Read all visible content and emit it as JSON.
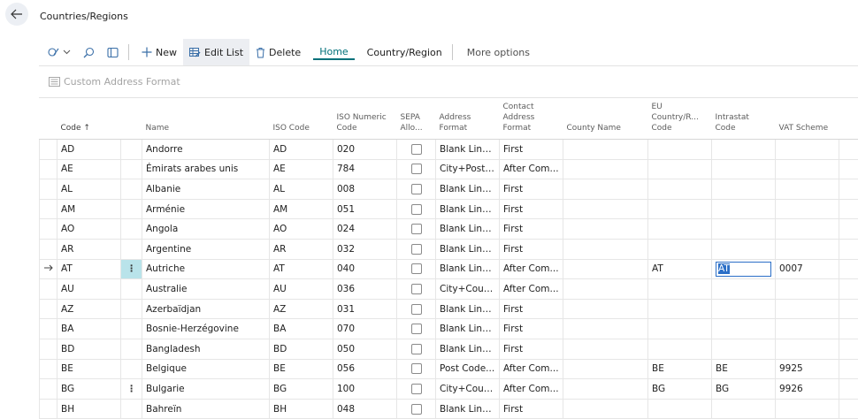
{
  "page": {
    "title": "Countries/Regions"
  },
  "toolbar": {
    "new_label": "New",
    "edit_list_label": "Edit List",
    "delete_label": "Delete",
    "home_label": "Home",
    "country_region_label": "Country/Region",
    "more_options_label": "More options"
  },
  "sub_actions": {
    "custom_address_format_label": "Custom Address Format"
  },
  "table": {
    "headers": {
      "code": "Code ↑",
      "name": "Name",
      "iso_code": "ISO Code",
      "iso_numeric_1": "ISO Numeric",
      "iso_numeric_2": "Code",
      "sepa_1": "SEPA",
      "sepa_2": "Allo...",
      "address_format_1": "Address",
      "address_format_2": "Format",
      "contact_1": "Contact",
      "contact_2": "Address",
      "contact_3": "Format",
      "county_name": "County Name",
      "eu_1": "EU",
      "eu_2": "Country/R...",
      "eu_3": "Code",
      "intrastat_1": "Intrastat",
      "intrastat_2": "Code",
      "vat_scheme": "VAT Scheme"
    },
    "rows": [
      {
        "code": "AD",
        "name": "Andorre",
        "iso": "AD",
        "num": "020",
        "addr": "Blank Line...",
        "contact": "First",
        "county": "",
        "eu": "",
        "intrastat": "",
        "vat": ""
      },
      {
        "code": "AE",
        "name": "Émirats arabes unis",
        "iso": "AE",
        "num": "784",
        "addr": "City+Post ...",
        "contact": "After Com...",
        "county": "",
        "eu": "",
        "intrastat": "",
        "vat": ""
      },
      {
        "code": "AL",
        "name": "Albanie",
        "iso": "AL",
        "num": "008",
        "addr": "Blank Line...",
        "contact": "First",
        "county": "",
        "eu": "",
        "intrastat": "",
        "vat": ""
      },
      {
        "code": "AM",
        "name": "Arménie",
        "iso": "AM",
        "num": "051",
        "addr": "Blank Line...",
        "contact": "First",
        "county": "",
        "eu": "",
        "intrastat": "",
        "vat": ""
      },
      {
        "code": "AO",
        "name": "Angola",
        "iso": "AO",
        "num": "024",
        "addr": "Blank Line...",
        "contact": "First",
        "county": "",
        "eu": "",
        "intrastat": "",
        "vat": ""
      },
      {
        "code": "AR",
        "name": "Argentine",
        "iso": "AR",
        "num": "032",
        "addr": "Blank Line...",
        "contact": "First",
        "county": "",
        "eu": "",
        "intrastat": "",
        "vat": ""
      },
      {
        "code": "AT",
        "name": "Autriche",
        "iso": "AT",
        "num": "040",
        "addr": "Blank Line...",
        "contact": "After Com...",
        "county": "",
        "eu": "AT",
        "intrastat": "AT",
        "vat": "0007"
      },
      {
        "code": "AU",
        "name": "Australie",
        "iso": "AU",
        "num": "036",
        "addr": "City+Coun...",
        "contact": "After Com...",
        "county": "",
        "eu": "",
        "intrastat": "",
        "vat": ""
      },
      {
        "code": "AZ",
        "name": "Azerbaïdjan",
        "iso": "AZ",
        "num": "031",
        "addr": "Blank Line...",
        "contact": "First",
        "county": "",
        "eu": "",
        "intrastat": "",
        "vat": ""
      },
      {
        "code": "BA",
        "name": "Bosnie-Herzégovine",
        "iso": "BA",
        "num": "070",
        "addr": "Blank Line...",
        "contact": "First",
        "county": "",
        "eu": "",
        "intrastat": "",
        "vat": ""
      },
      {
        "code": "BD",
        "name": "Bangladesh",
        "iso": "BD",
        "num": "050",
        "addr": "Blank Line...",
        "contact": "First",
        "county": "",
        "eu": "",
        "intrastat": "",
        "vat": ""
      },
      {
        "code": "BE",
        "name": "Belgique",
        "iso": "BE",
        "num": "056",
        "addr": "Post Code...",
        "contact": "After Com...",
        "county": "",
        "eu": "BE",
        "intrastat": "BE",
        "vat": "9925"
      },
      {
        "code": "BG",
        "name": "Bulgarie",
        "iso": "BG",
        "num": "100",
        "addr": "City+Coun...",
        "contact": "After Com...",
        "county": "",
        "eu": "BG",
        "intrastat": "BG",
        "vat": "9926"
      },
      {
        "code": "BH",
        "name": "Bahreïn",
        "iso": "BH",
        "num": "048",
        "addr": "Blank Line...",
        "contact": "First",
        "county": "",
        "eu": "",
        "intrastat": "",
        "vat": ""
      }
    ]
  }
}
